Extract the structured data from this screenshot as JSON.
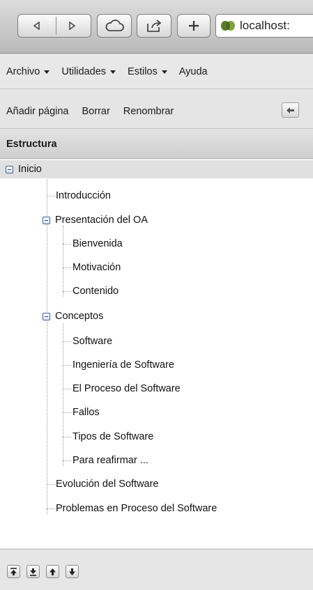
{
  "browser": {
    "address": "localhost:"
  },
  "menu": {
    "archivo": "Archivo",
    "utilidades": "Utilidades",
    "estilos": "Estilos",
    "ayuda": "Ayuda"
  },
  "actions": {
    "add_page": "Añadir página",
    "delete": "Borrar",
    "rename": "Renombrar"
  },
  "structure": {
    "title": "Estructura",
    "root": "Inicio",
    "introduccion": "Introducción",
    "presentacion": "Presentación del OA",
    "bienvenida": "Bienvenida",
    "motivacion": "Motivación",
    "contenido": "Contenido",
    "conceptos": "Conceptos",
    "software": "Software",
    "ingenieria": "Ingeniería de Software",
    "proceso": "El Proceso del Software",
    "fallos": "Fallos",
    "tipos": "Tipos de Software",
    "reafirmar": "Para reafirmar ...",
    "evolucion": "Evolución del Software",
    "problemas": "Problemas en Proceso del Software"
  }
}
